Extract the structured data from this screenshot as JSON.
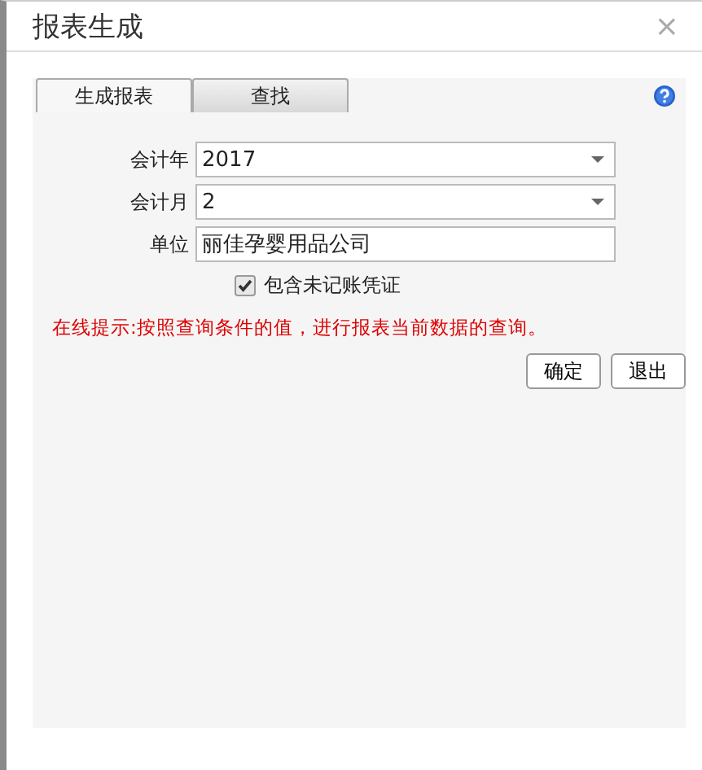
{
  "window": {
    "title": "报表生成",
    "close": "×"
  },
  "tabs": [
    {
      "label": "生成报表",
      "selected": true
    },
    {
      "label": "查找",
      "selected": false
    }
  ],
  "form": [
    {
      "kind": "select",
      "label": "会计年",
      "value": "2017"
    },
    {
      "kind": "select",
      "label": "会计月",
      "value": "2"
    },
    {
      "kind": "text",
      "label": "单位",
      "value": "丽佳孕婴用品公司"
    }
  ],
  "checkbox": {
    "label": "包含未记账凭证",
    "checked": true
  },
  "hint": "在线提示:按照查询条件的值，进行报表当前数据的查询。",
  "buttons": [
    "确定",
    "退出"
  ]
}
